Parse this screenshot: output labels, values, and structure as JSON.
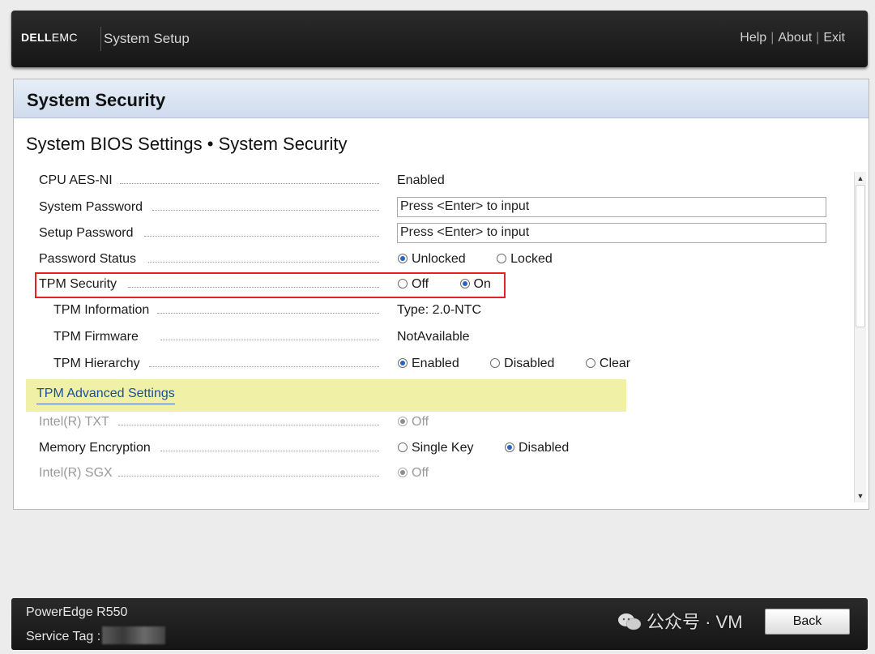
{
  "header": {
    "logo_dell": "DELL",
    "logo_emc": "EMC",
    "title": "System Setup",
    "links": {
      "help": "Help",
      "about": "About",
      "exit": "Exit",
      "sep": "|"
    }
  },
  "panel": {
    "title": "System Security",
    "breadcrumb": "System BIOS Settings • System Security"
  },
  "settings": {
    "cpu_aes": {
      "label": "CPU AES-NI",
      "value": "Enabled"
    },
    "system_password": {
      "label": "System Password",
      "value": "Press <Enter> to input"
    },
    "setup_password": {
      "label": "Setup Password",
      "value": "Press <Enter> to input"
    },
    "password_status": {
      "label": "Password Status",
      "opt1": "Unlocked",
      "opt2": "Locked",
      "selected": "Unlocked"
    },
    "tpm_security": {
      "label": "TPM Security",
      "opt1": "Off",
      "opt2": "On",
      "selected": "On"
    },
    "tpm_information": {
      "label": "TPM Information",
      "value": "Type: 2.0-NTC"
    },
    "tpm_firmware": {
      "label": "TPM Firmware",
      "value": "NotAvailable"
    },
    "tpm_hierarchy": {
      "label": "TPM Hierarchy",
      "opt1": "Enabled",
      "opt2": "Disabled",
      "opt3": "Clear",
      "selected": "Enabled"
    },
    "tpm_advanced": {
      "label": "TPM Advanced Settings"
    },
    "intel_txt": {
      "label": "Intel(R) TXT",
      "value": "Off"
    },
    "memory_encryption": {
      "label": "Memory Encryption",
      "opt1": "Single Key",
      "opt2": "Disabled",
      "selected": "Disabled"
    },
    "intel_sgx": {
      "label": "Intel(R) SGX",
      "value": "Off"
    }
  },
  "footer": {
    "model": "PowerEdge R550",
    "service_tag_label": "Service Tag :",
    "back": "Back"
  },
  "watermark": {
    "text": "公众号 · VM"
  },
  "colors": {
    "highlight": "#e52222",
    "accent": "#2563c7",
    "advanced_bg": "#f0f0a6"
  }
}
